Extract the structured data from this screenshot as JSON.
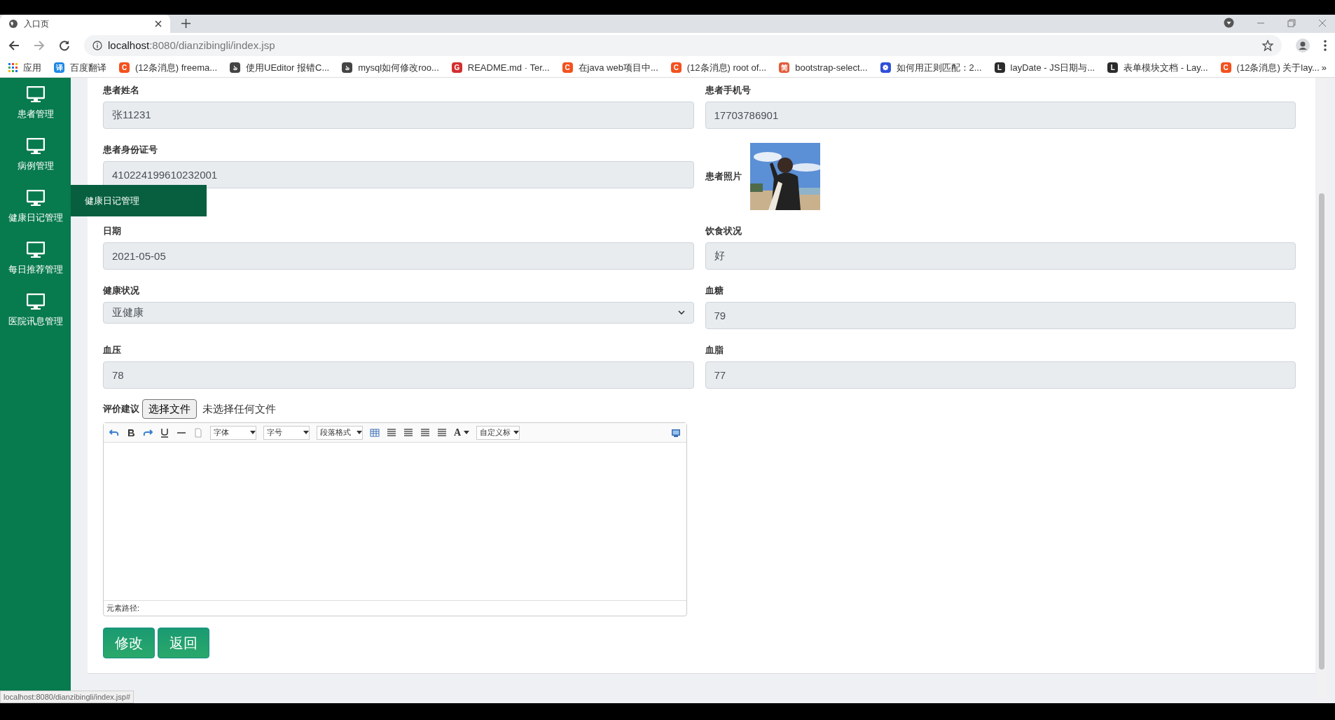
{
  "browser": {
    "tab_title": "入口页",
    "url_host": "localhost",
    "url_rest": ":8080/dianzibingli/index.jsp",
    "apps_label": "应用",
    "bookmarks": [
      {
        "label": "百度翻译",
        "color": "#1e88e5",
        "glyph": "译"
      },
      {
        "label": "(12条消息) freema...",
        "color": "#f4511e",
        "glyph": "C"
      },
      {
        "label": "使用UEditor 报错C...",
        "color": "#444444",
        "glyph": "ঌ"
      },
      {
        "label": "mysql如何修改roo...",
        "color": "#444444",
        "glyph": "ঌ"
      },
      {
        "label": "README.md · Ter...",
        "color": "#d32f2f",
        "glyph": "G"
      },
      {
        "label": "在java web项目中...",
        "color": "#f4511e",
        "glyph": "C"
      },
      {
        "label": "(12条消息) root of...",
        "color": "#f4511e",
        "glyph": "C"
      },
      {
        "label": "bootstrap-select...",
        "color": "#e25b3a",
        "glyph": "简"
      },
      {
        "label": "如何用正则匹配：2...",
        "color": "#2f4fd8",
        "glyph": "❁"
      },
      {
        "label": "layDate - JS日期与...",
        "color": "#2b2b2b",
        "glyph": "L"
      },
      {
        "label": "表单模块文档 - Lay...",
        "color": "#2b2b2b",
        "glyph": "L"
      },
      {
        "label": "(12条消息) 关于lay...",
        "color": "#f4511e",
        "glyph": "C"
      }
    ],
    "more": "»",
    "status_url": "localhost:8080/dianzibingli/index.jsp#"
  },
  "sidebar": {
    "items": [
      {
        "label": "患者管理"
      },
      {
        "label": "病例管理"
      },
      {
        "label": "健康日记管理"
      },
      {
        "label": "每日推荐管理"
      },
      {
        "label": "医院讯息管理"
      }
    ],
    "flyout": "健康日记管理"
  },
  "form": {
    "fields": [
      {
        "kind": "input",
        "label": "患者姓名",
        "value": "张11231"
      },
      {
        "kind": "input",
        "label": "患者手机号",
        "value": "17703786901"
      },
      {
        "kind": "input",
        "label": "患者身份证号",
        "value": "410224199610232001"
      },
      {
        "label": "患者照片"
      },
      {
        "kind": "input",
        "label": "日期",
        "value": "2021-05-05"
      },
      {
        "kind": "input",
        "label": "饮食状况",
        "value": "好"
      },
      {
        "kind": "select",
        "label": "健康状况",
        "value": "亚健康"
      },
      {
        "kind": "input",
        "label": "血糖",
        "value": "79"
      },
      {
        "kind": "input",
        "label": "血压",
        "value": "78"
      },
      {
        "kind": "input",
        "label": "血脂",
        "value": "77"
      }
    ],
    "file": {
      "label": "评价建议",
      "button": "选择文件",
      "status": "未选择任何文件"
    },
    "editor": {
      "dropdowns": [
        "字体",
        "字号",
        "段落格式"
      ],
      "color_glyph": "A",
      "custom": "自定义标",
      "path_label": "元素路径:"
    },
    "buttons": [
      "修改",
      "返回"
    ]
  }
}
